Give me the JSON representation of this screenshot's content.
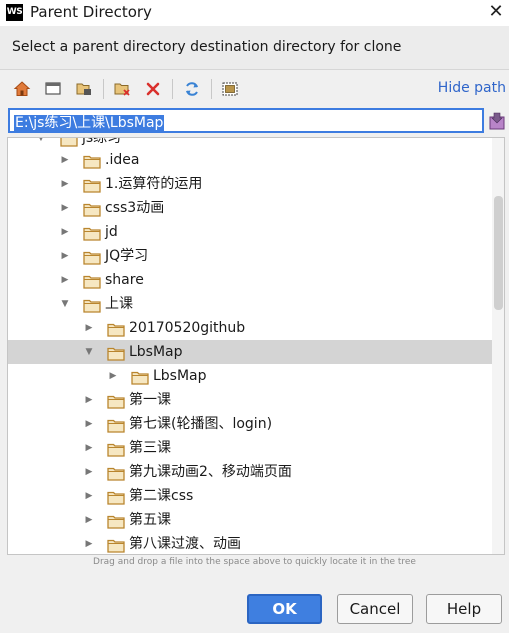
{
  "window": {
    "title": "Parent Directory",
    "app_icon_text": "WS",
    "close_glyph": "✕"
  },
  "subtitle": "Select a parent directory destination directory for clone",
  "toolbar": {
    "icons": [
      "home-icon",
      "desktop-icon",
      "project-icon",
      "new-folder-icon",
      "delete-icon",
      "refresh-icon",
      "show-hidden-icon"
    ],
    "hide_path_label": "Hide path"
  },
  "path": {
    "value": "E:\\js练习\\上课\\LbsMap"
  },
  "tree": {
    "partial_top_label": "js练习",
    "items": [
      {
        "label": ".idea",
        "depth": 0,
        "expanded": false,
        "selected": false
      },
      {
        "label": "1.运算符的运用",
        "depth": 0,
        "expanded": false,
        "selected": false
      },
      {
        "label": "css3动画",
        "depth": 0,
        "expanded": false,
        "selected": false
      },
      {
        "label": "jd",
        "depth": 0,
        "expanded": false,
        "selected": false
      },
      {
        "label": "JQ学习",
        "depth": 0,
        "expanded": false,
        "selected": false
      },
      {
        "label": "share",
        "depth": 0,
        "expanded": false,
        "selected": false
      },
      {
        "label": "上课",
        "depth": 0,
        "expanded": true,
        "selected": false
      },
      {
        "label": "20170520github",
        "depth": 1,
        "expanded": false,
        "selected": false
      },
      {
        "label": "LbsMap",
        "depth": 1,
        "expanded": true,
        "selected": true
      },
      {
        "label": "LbsMap",
        "depth": 2,
        "expanded": false,
        "selected": false
      },
      {
        "label": "第一课",
        "depth": 1,
        "expanded": false,
        "selected": false
      },
      {
        "label": "第七课(轮播图、login)",
        "depth": 1,
        "expanded": false,
        "selected": false
      },
      {
        "label": "第三课",
        "depth": 1,
        "expanded": false,
        "selected": false
      },
      {
        "label": "第九课动画2、移动端页面",
        "depth": 1,
        "expanded": false,
        "selected": false
      },
      {
        "label": "第二课css",
        "depth": 1,
        "expanded": false,
        "selected": false
      },
      {
        "label": "第五课",
        "depth": 1,
        "expanded": false,
        "selected": false
      },
      {
        "label": "第八课过渡、动画",
        "depth": 1,
        "expanded": false,
        "selected": false
      }
    ]
  },
  "hint": "Drag and drop a file into the space above to quickly locate it in the tree",
  "buttons": {
    "ok": "OK",
    "cancel": "Cancel",
    "help": "Help"
  },
  "colors": {
    "accent": "#3f7fe0",
    "folder": "#d8a14a",
    "selection": "#d4d4d4",
    "link": "#2f65ca"
  }
}
